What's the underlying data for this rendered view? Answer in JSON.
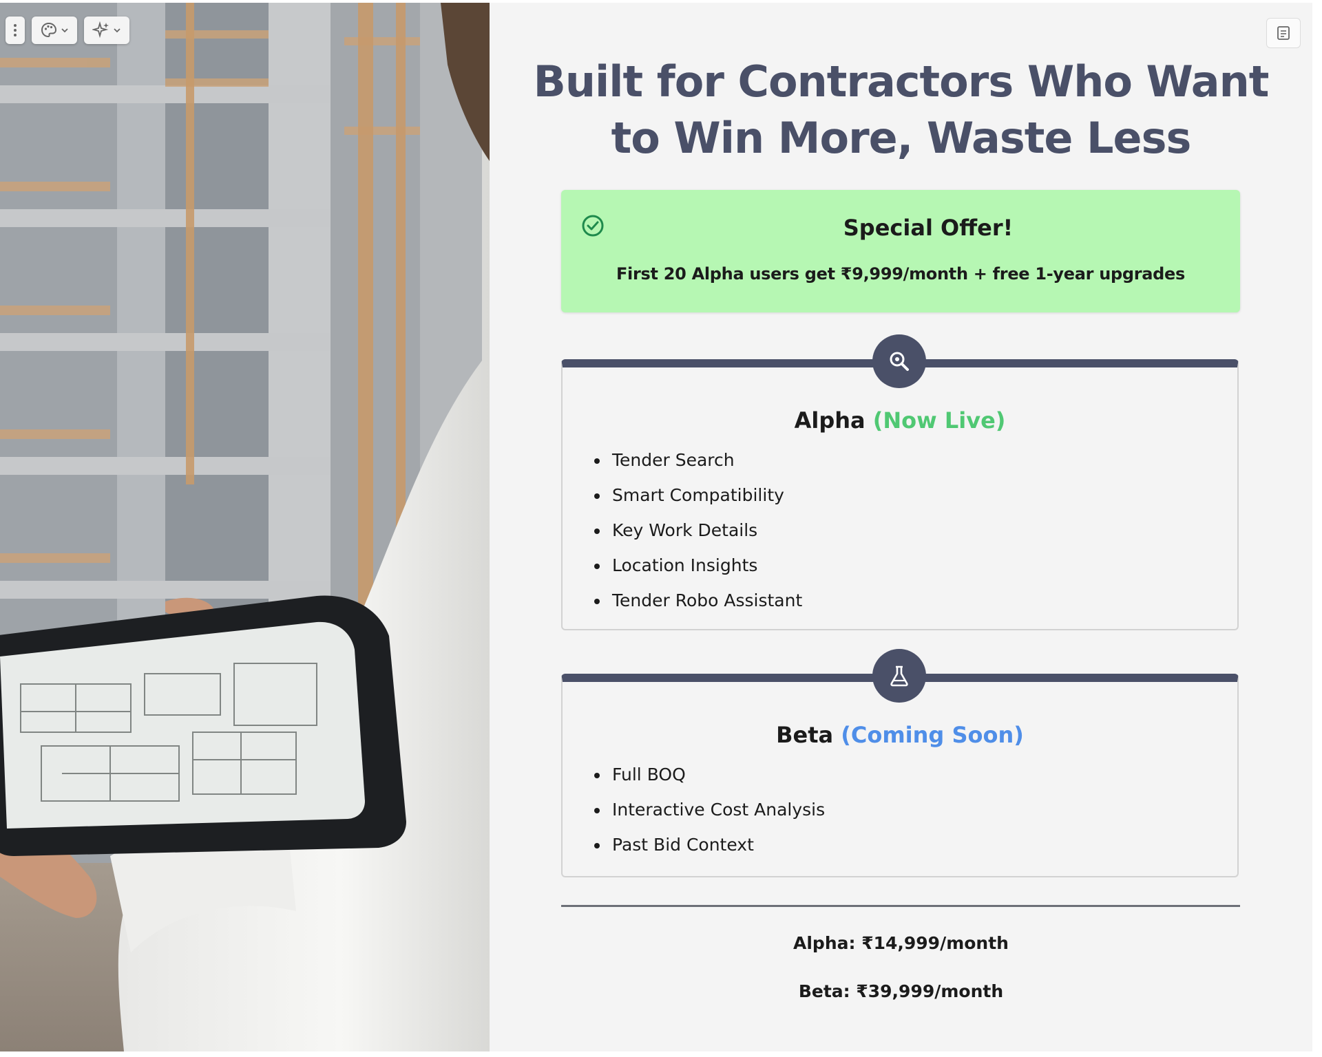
{
  "toolbar": {
    "menu_icon": "vertical-dots-icon",
    "theme_icon": "palette-icon",
    "ai_icon": "sparkles-icon",
    "notes_icon": "notes-icon"
  },
  "headline": {
    "line1": "Built for Contractors Who Want",
    "line2": "to Win More, Waste Less"
  },
  "offer": {
    "title": "Special Offer!",
    "text": "First 20 Alpha users get ₹9,999/month + free 1-year upgrades",
    "color": "#b6f7b3"
  },
  "alpha": {
    "icon": "search-gear-icon",
    "title": "Alpha",
    "status": "(Now Live)",
    "status_color": "#50c873",
    "features": [
      "Tender Search",
      "Smart Compatibility",
      "Key Work Details",
      "Location Insights",
      "Tender Robo Assistant"
    ]
  },
  "beta": {
    "icon": "flask-icon",
    "title": "Beta",
    "status": "(Coming Soon)",
    "status_color": "#4f8ee8",
    "features": [
      "Full BOQ",
      "Interactive Cost Analysis",
      "Past Bid Context"
    ]
  },
  "pricing": {
    "alpha": "Alpha: ₹14,999/month",
    "beta": "Beta: ₹39,999/month"
  },
  "colors": {
    "heading": "#4a5068",
    "card_accent": "#4a5068",
    "panel_bg": "#f4f4f4"
  }
}
